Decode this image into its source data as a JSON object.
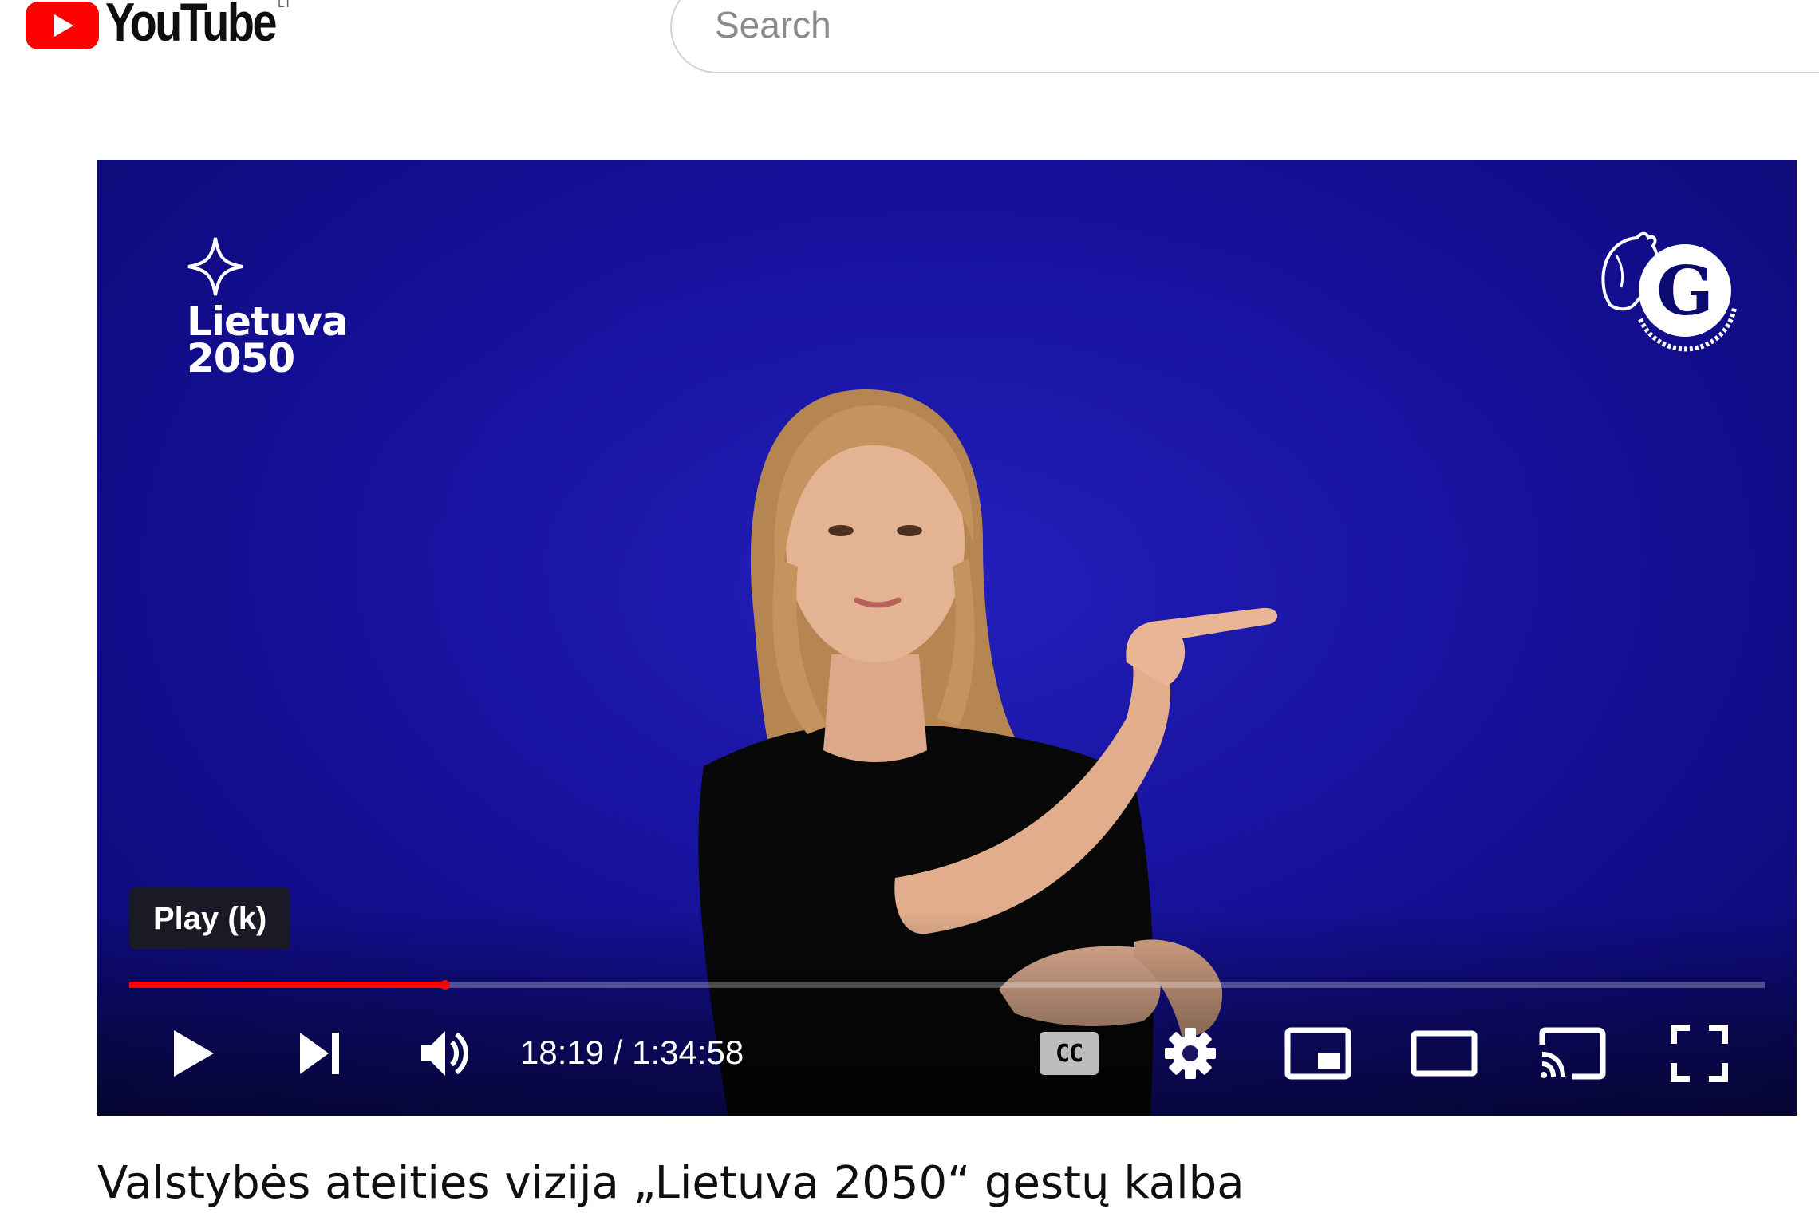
{
  "header": {
    "logo_text": "YouTube",
    "country_code": "LT",
    "search_placeholder": "Search"
  },
  "player": {
    "overlay_brand": {
      "line1": "Lietuva",
      "line2": "2050"
    },
    "tooltip": "Play (k)",
    "progress_fraction": 0.193,
    "current_time": "18:19",
    "duration": "1:34:58",
    "time_separator": " / ",
    "cc_label": "CC",
    "controls": [
      "play",
      "next",
      "volume",
      "subtitles",
      "settings",
      "miniplayer",
      "theater",
      "cast",
      "fullscreen"
    ]
  },
  "video": {
    "title": "Valstybės ateities vizija „Lietuva 2050“ gestų kalba"
  },
  "colors": {
    "brand_red": "#ff0000",
    "progress_played": "#ff0000",
    "video_background": "#1712a4"
  }
}
